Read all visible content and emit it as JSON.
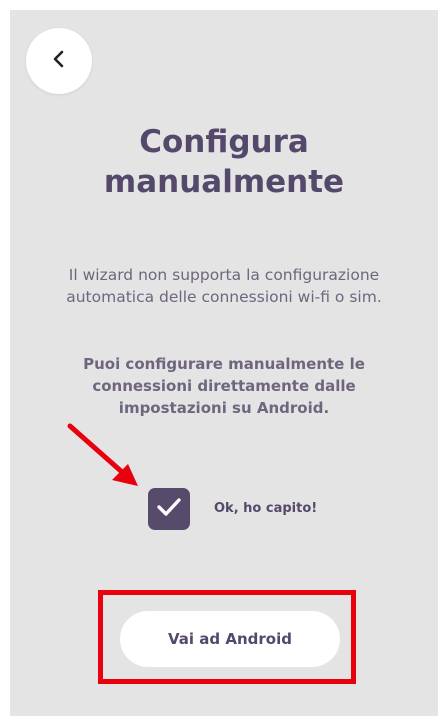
{
  "header": {
    "back_icon": "chevron-left-icon"
  },
  "title": {
    "line1": "Configura",
    "line2": "manualmente"
  },
  "info": {
    "line1": "Il wizard non supporta la configurazione",
    "line2": "automatica delle connessioni wi-fi o sim."
  },
  "instructions": {
    "line1": "Puoi configurare manualmente le",
    "line2": "connessioni direttamente dalle",
    "line3": "impostazioni su Android."
  },
  "confirm": {
    "checked": true,
    "label": "Ok, ho capito!"
  },
  "cta": {
    "label": "Vai ad Android"
  },
  "colors": {
    "background": "#e4e4e4",
    "primary": "#55496b",
    "text": "#6f667e",
    "annotation": "#e8000c"
  }
}
